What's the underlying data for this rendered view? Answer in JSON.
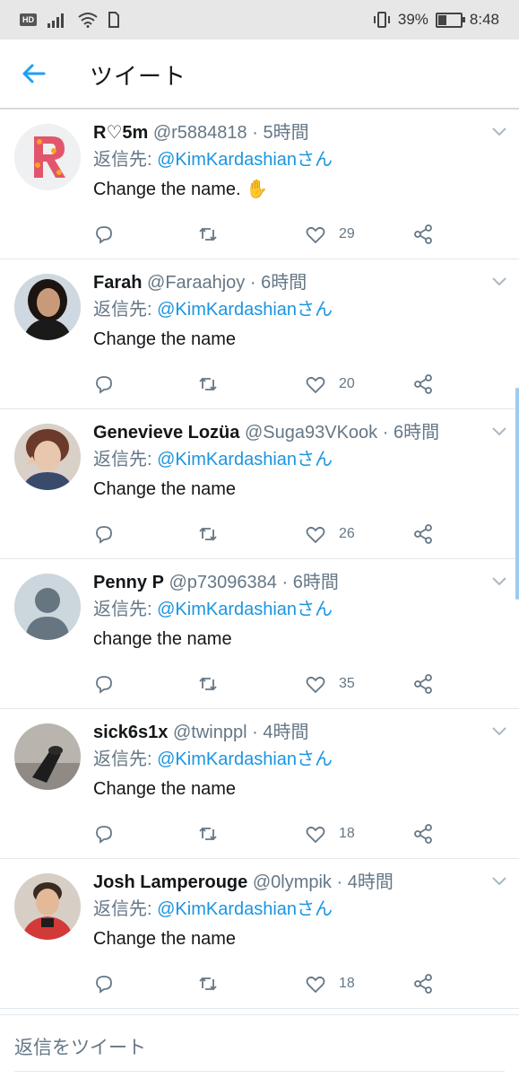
{
  "status_bar": {
    "hd": "HD",
    "battery_text": "39%",
    "battery_level": 0.39,
    "time": "8:48",
    "icons": [
      "signal-icon",
      "wifi-icon",
      "sim-icon",
      "vibrate-icon",
      "battery-icon"
    ]
  },
  "header": {
    "title": "ツイート",
    "back_icon": "arrow-left-icon",
    "accent": "#1da1f2"
  },
  "reply_prefix": "返信先:",
  "reply_target": "@KimKardashianさん",
  "tweets": [
    {
      "name": "R♡5m",
      "handle": "@r5884818",
      "sep": "·",
      "time": "5時間",
      "text": "Change the name. ✋",
      "likes": "29"
    },
    {
      "name": "Farah",
      "handle": "@Faraahjoy",
      "sep": "·",
      "time": "6時間",
      "text": "Change the name",
      "likes": "20"
    },
    {
      "name": "Genevieve Lozüa",
      "handle": "@Suga93VKook",
      "sep": "·",
      "time": "6時間",
      "text": "Change the name",
      "likes": "26"
    },
    {
      "name": "Penny P",
      "handle": "@p73096384",
      "sep": "·",
      "time": "6時間",
      "text": "change the name",
      "likes": "35"
    },
    {
      "name": "sick6s1x",
      "handle": "@twinppl",
      "sep": "·",
      "time": "4時間",
      "text": "Change the name",
      "likes": "18"
    },
    {
      "name": "Josh Lamperouge",
      "handle": "@0lympik",
      "sep": "·",
      "time": "4時間",
      "text": "Change the name",
      "likes": "18"
    }
  ],
  "reply_bar": {
    "placeholder": "返信をツイート"
  },
  "colors": {
    "link": "#1b95e0",
    "muted": "#657786",
    "divider": "#e1e8ed"
  }
}
